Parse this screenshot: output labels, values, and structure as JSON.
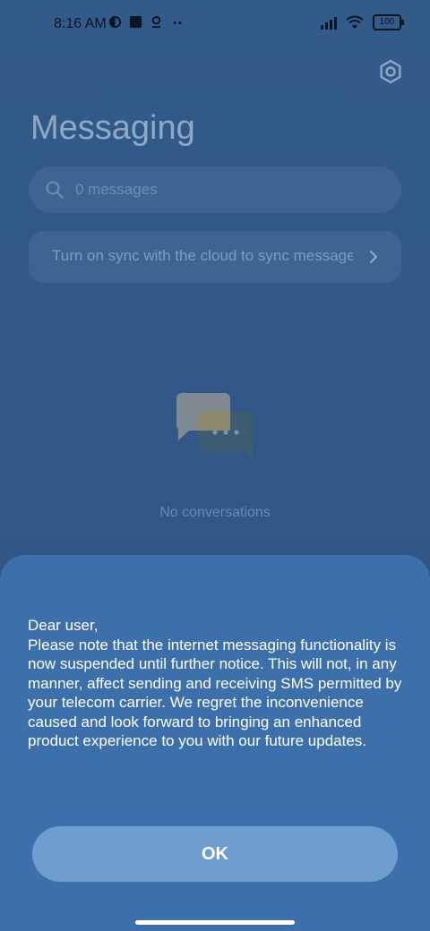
{
  "status": {
    "time": "8:16 AM",
    "battery": "100",
    "icons": [
      "app-circle-icon",
      "square-icon",
      "location-pin-icon",
      "more-dots-icon"
    ]
  },
  "header": {
    "title": "Messaging",
    "settings_icon": "gear-icon"
  },
  "search": {
    "placeholder": "0 messages"
  },
  "sync_banner": {
    "text": "Turn on sync with the cloud to sync messages"
  },
  "empty_state": {
    "text": "No conversations"
  },
  "dialog": {
    "message": "Dear user,\nPlease note that the internet messaging functionality is now suspended until further notice. This will not, in any manner, affect sending and receiving SMS permitted by your telecom carrier. We regret the inconvenience caused and look forward to bringing an enhanced product experience to you with our future updates.",
    "ok_label": "OK"
  },
  "colors": {
    "background": "#2f5584",
    "dialog": "#3d70ab",
    "button": "#6f9dd0"
  }
}
